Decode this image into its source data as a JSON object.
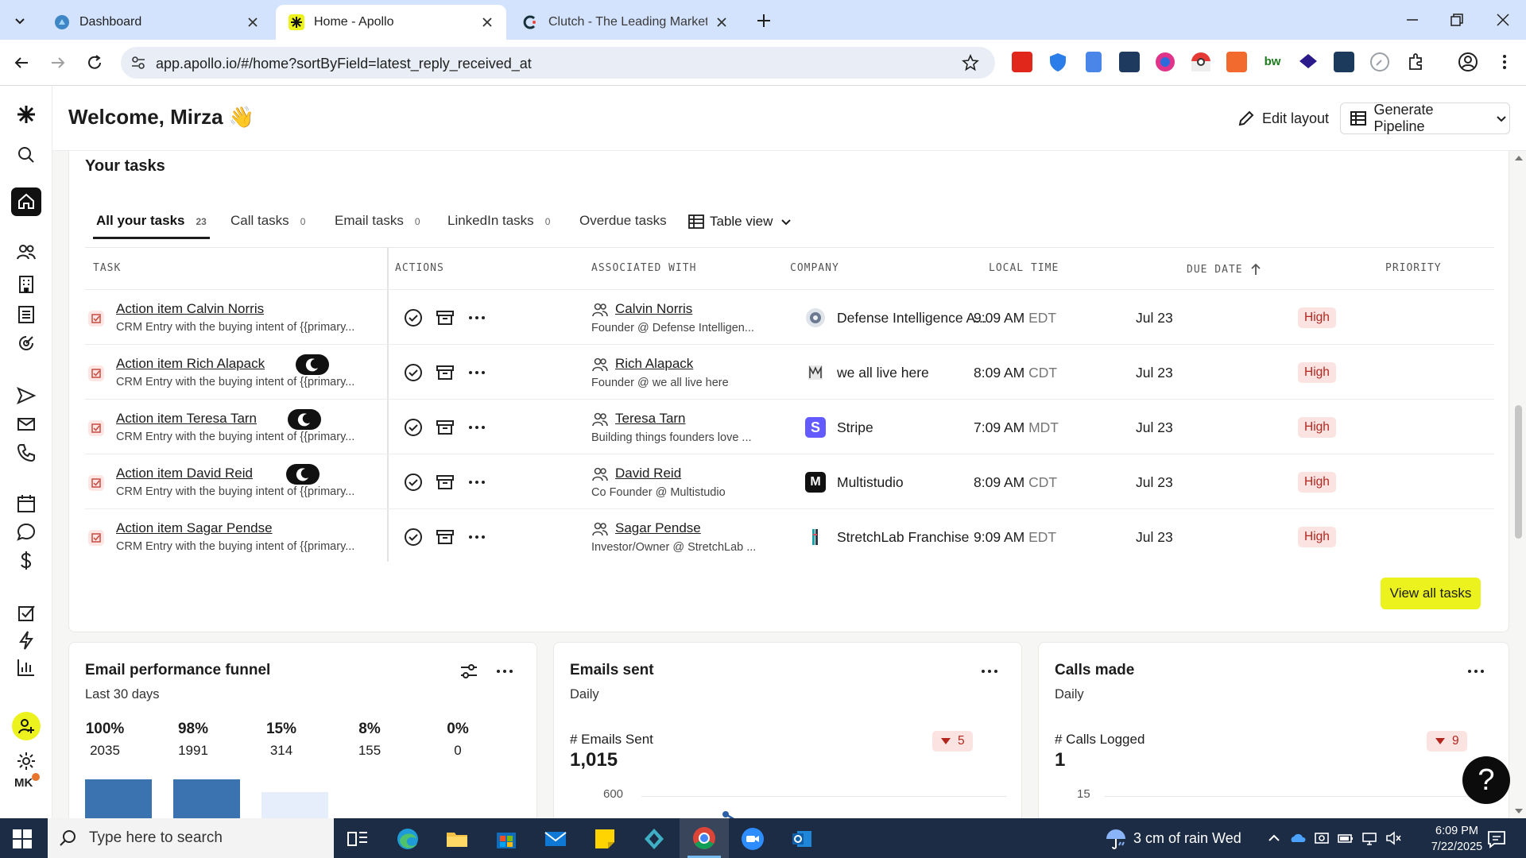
{
  "browser": {
    "tabs": [
      {
        "title": "Dashboard"
      },
      {
        "title": "Home - Apollo"
      },
      {
        "title": "Clutch - The Leading Marketpla"
      }
    ],
    "url": "app.apollo.io/#/home?sortByField=latest_reply_received_at"
  },
  "header": {
    "welcome": "Welcome, Mirza 👋",
    "edit_layout": "Edit layout",
    "generate_pipeline": "Generate Pipeline"
  },
  "rail": {
    "avatar_initials": "MK"
  },
  "tasks": {
    "title": "Your tasks",
    "tabs": [
      {
        "label": "All your tasks",
        "count": "23"
      },
      {
        "label": "Call tasks",
        "count": "0"
      },
      {
        "label": "Email tasks",
        "count": "0"
      },
      {
        "label": "LinkedIn tasks",
        "count": "0"
      },
      {
        "label": "Overdue tasks",
        "count": ""
      }
    ],
    "view_label": "Table view",
    "columns": [
      "TASK",
      "ACTIONS",
      "ASSOCIATED WITH",
      "COMPANY",
      "LOCAL TIME",
      "DUE DATE",
      "PRIORITY"
    ],
    "rows": [
      {
        "title": "Action item Calvin Norris",
        "subtitle": "CRM Entry with the buying intent of {{primary...",
        "person": "Calvin Norris",
        "person_sub": "Founder @ Defense Intelligen...",
        "company": "Defense Intelligence A...",
        "time": "9:09 AM",
        "tz": "EDT",
        "due": "Jul 23",
        "priority": "High",
        "snoozed": false
      },
      {
        "title": "Action item Rich Alapack",
        "subtitle": "CRM Entry with the buying intent of {{primary...",
        "person": "Rich Alapack",
        "person_sub": "Founder @ we all live here",
        "company": "we all live here",
        "time": "8:09 AM",
        "tz": "CDT",
        "due": "Jul 23",
        "priority": "High",
        "snoozed": true
      },
      {
        "title": "Action item Teresa Tarn",
        "subtitle": "CRM Entry with the buying intent of {{primary...",
        "person": "Teresa Tarn",
        "person_sub": "Building things founders love ...",
        "company": "Stripe",
        "time": "7:09 AM",
        "tz": "MDT",
        "due": "Jul 23",
        "priority": "High",
        "snoozed": true
      },
      {
        "title": "Action item David Reid",
        "subtitle": "CRM Entry with the buying intent of {{primary...",
        "person": "David Reid",
        "person_sub": "Co Founder @ Multistudio",
        "company": "Multistudio",
        "time": "8:09 AM",
        "tz": "CDT",
        "due": "Jul 23",
        "priority": "High",
        "snoozed": true
      },
      {
        "title": "Action item Sagar Pendse",
        "subtitle": "CRM Entry with the buying intent of {{primary...",
        "person": "Sagar Pendse",
        "person_sub": "Investor/Owner @ StretchLab ...",
        "company": "StretchLab Franchise",
        "time": "9:09 AM",
        "tz": "EDT",
        "due": "Jul 23",
        "priority": "High",
        "snoozed": false
      }
    ],
    "view_all": "View all tasks"
  },
  "funnel": {
    "title": "Email performance funnel",
    "subtitle": "Last 30 days",
    "stages": [
      {
        "pct": "100%",
        "count": "2035",
        "fill": 1.0,
        "color": "#3b73b0"
      },
      {
        "pct": "98%",
        "count": "1991",
        "fill": 0.98,
        "color": "#3b73b0"
      },
      {
        "pct": "15%",
        "count": "314",
        "fill": 0.15,
        "color": "#e6eefb"
      },
      {
        "pct": "8%",
        "count": "155",
        "fill": 0.08,
        "color": "#e6eefb"
      },
      {
        "pct": "0%",
        "count": "0",
        "fill": 0.0,
        "color": "#e6eefb"
      }
    ]
  },
  "emails_sent": {
    "title": "Emails sent",
    "subtitle": "Daily",
    "metric_label": "# Emails Sent",
    "metric_value": "1,015",
    "delta": "5",
    "axis_top": "600"
  },
  "calls_made": {
    "title": "Calls made",
    "subtitle": "Daily",
    "metric_label": "# Calls Logged",
    "metric_value": "1",
    "delta": "9",
    "axis_top": "15"
  },
  "taskbar": {
    "search_placeholder": "Type here to search",
    "weather": "3 cm of rain Wed",
    "time": "6:09 PM",
    "date": "7/22/2025"
  },
  "colors": {
    "accent_yellow": "#ebf21e",
    "priority_bg": "#fbe3e1",
    "priority_text": "#b2261e",
    "funnel_blue": "#3b73b0"
  }
}
